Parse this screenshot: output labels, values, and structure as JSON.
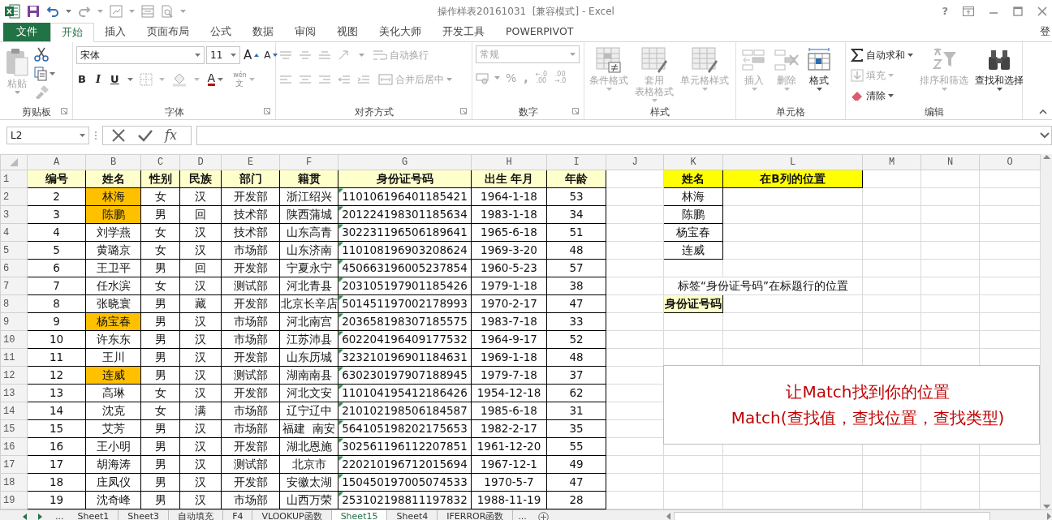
{
  "title_bar": {
    "title": "操作样表20161031  [兼容模式] - Excel",
    "help": "?"
  },
  "ribbon_tabs": [
    {
      "label": "文件",
      "kind": "file",
      "selected": false
    },
    {
      "label": "开始",
      "kind": "tab",
      "selected": true
    },
    {
      "label": "插入",
      "kind": "tab",
      "selected": false
    },
    {
      "label": "页面布局",
      "kind": "tab",
      "selected": false
    },
    {
      "label": "公式",
      "kind": "tab",
      "selected": false
    },
    {
      "label": "数据",
      "kind": "tab",
      "selected": false
    },
    {
      "label": "审阅",
      "kind": "tab",
      "selected": false
    },
    {
      "label": "视图",
      "kind": "tab",
      "selected": false
    },
    {
      "label": "美化大师",
      "kind": "tab",
      "selected": false
    },
    {
      "label": "开发工具",
      "kind": "tab",
      "selected": false
    },
    {
      "label": "POWERPIVOT",
      "kind": "tab",
      "selected": false
    }
  ],
  "account": "登",
  "ribbon": {
    "clipboard": {
      "title": "剪贴板",
      "paste": {
        "label": "粘贴",
        "disabled": true
      }
    },
    "font": {
      "title": "字体",
      "font_name": "宋体",
      "font_size": "11",
      "grow": "A",
      "shrink": "A",
      "bold": "B",
      "italic": "I",
      "underline": "U",
      "font_color": "A",
      "phonetic_top": "wén",
      "phonetic_bottom": "文"
    },
    "alignment": {
      "title": "对齐方式",
      "disabled": true,
      "wrap_text": "自动换行",
      "merge_center": "合并后居中"
    },
    "number": {
      "title": "数字",
      "disabled": true,
      "format": "常规",
      "percent": "%",
      "comma": ",",
      "increase_decimal": [
        "←.0",
        ".00"
      ],
      "decrease_decimal": [
        ".00",
        "→.0"
      ]
    },
    "styles": {
      "title": "样式",
      "buttons": [
        {
          "kind": "conditional",
          "lines": [
            "条件格式"
          ],
          "disabled": true
        },
        {
          "kind": "table",
          "lines": [
            "套用",
            "表格格式"
          ],
          "disabled": true
        },
        {
          "kind": "cellstyle",
          "lines": [
            "单元格样式"
          ],
          "disabled": true
        }
      ]
    },
    "cells": {
      "title": "单元格",
      "buttons": [
        {
          "kind": "insert",
          "lines": [
            "插入"
          ],
          "disabled": true
        },
        {
          "kind": "delete",
          "lines": [
            "删除"
          ],
          "disabled": true
        },
        {
          "kind": "format",
          "lines": [
            "格式"
          ],
          "disabled": false
        }
      ]
    },
    "editing": {
      "title": "编辑",
      "small": [
        {
          "kind": "sum",
          "label": "自动求和",
          "disabled": false
        },
        {
          "kind": "fill",
          "label": "填充",
          "disabled": true
        },
        {
          "kind": "clear",
          "label": "清除",
          "disabled": false
        }
      ],
      "large": [
        {
          "kind": "sort",
          "lines": [
            "排序和筛选"
          ],
          "disabled": true
        },
        {
          "kind": "find",
          "lines": [
            "查找和选择"
          ],
          "disabled": false
        }
      ]
    }
  },
  "formula_bar": {
    "name_box": "L2",
    "function_label": "fx"
  },
  "columns": [
    "A",
    "B",
    "C",
    "D",
    "E",
    "F",
    "G",
    "H",
    "I",
    "J",
    "K",
    "L",
    "M",
    "N",
    "O"
  ],
  "row_numbers": [
    "1",
    "2",
    "3",
    "4",
    "5",
    "6",
    "7",
    "8",
    "9",
    "10",
    "11",
    "12",
    "13",
    "14",
    "15",
    "16",
    "17",
    "18",
    "19"
  ],
  "table": {
    "header": [
      "编号",
      "姓名",
      "性别",
      "民族",
      "部门",
      "籍贯",
      "身份证号码",
      "出生 年月",
      "年龄"
    ],
    "rows": [
      {
        "values": [
          "2",
          "林海",
          "女",
          "汉",
          "开发部",
          "浙江绍兴",
          "110106196401185421",
          "1964-1-18",
          "53"
        ],
        "name_highlighted": true
      },
      {
        "values": [
          "3",
          "陈鹏",
          "男",
          "回",
          "技术部",
          "陕西蒲城",
          "201224198301185634",
          "1983-1-18",
          "34"
        ],
        "name_highlighted": true
      },
      {
        "values": [
          "4",
          "刘学燕",
          "女",
          "汉",
          "技术部",
          "山东高青",
          "302231196506189641",
          "1965-6-18",
          "51"
        ],
        "name_highlighted": false
      },
      {
        "values": [
          "5",
          "黄璐京",
          "女",
          "汉",
          "市场部",
          "山东济南",
          "110108196903208624",
          "1969-3-20",
          "48"
        ],
        "name_highlighted": false
      },
      {
        "values": [
          "6",
          "王卫平",
          "男",
          "回",
          "开发部",
          "宁夏永宁",
          "450663196005237854",
          "1960-5-23",
          "57"
        ],
        "name_highlighted": false
      },
      {
        "values": [
          "7",
          "任水滨",
          "女",
          "汉",
          "测试部",
          "河北青县",
          "203105197901185426",
          "1979-1-18",
          "38"
        ],
        "name_highlighted": false
      },
      {
        "values": [
          "8",
          "张晓寰",
          "男",
          "藏",
          "开发部",
          "北京长辛店",
          "501451197002178993",
          "1970-2-17",
          "47"
        ],
        "name_highlighted": false
      },
      {
        "values": [
          "9",
          "杨宝春",
          "男",
          "汉",
          "市场部",
          "河北南宫",
          "203658198307185575",
          "1983-7-18",
          "33"
        ],
        "name_highlighted": true
      },
      {
        "values": [
          "10",
          "许东东",
          "男",
          "汉",
          "市场部",
          "江苏沛县",
          "602204196409177532",
          "1964-9-17",
          "52"
        ],
        "name_highlighted": false
      },
      {
        "values": [
          "11",
          "王川",
          "男",
          "汉",
          "开发部",
          "山东历城",
          "323210196901184631",
          "1969-1-18",
          "48"
        ],
        "name_highlighted": false
      },
      {
        "values": [
          "12",
          "连威",
          "男",
          "汉",
          "测试部",
          "湖南南县",
          "630230197907188945",
          "1979-7-18",
          "37"
        ],
        "name_highlighted": true
      },
      {
        "values": [
          "13",
          "高琳",
          "女",
          "汉",
          "开发部",
          "河北文安",
          "110104195412186426",
          "1954-12-18",
          "62"
        ],
        "name_highlighted": false
      },
      {
        "values": [
          "14",
          "沈克",
          "女",
          "满",
          "市场部",
          "辽宁辽中",
          "210102198506184587",
          "1985-6-18",
          "31"
        ],
        "name_highlighted": false
      },
      {
        "values": [
          "15",
          "艾芳",
          "男",
          "汉",
          "市场部",
          "福建  南安",
          "564105198202175653",
          "1982-2-17",
          "35"
        ],
        "name_highlighted": false
      },
      {
        "values": [
          "16",
          "王小明",
          "男",
          "汉",
          "开发部",
          "湖北恩施",
          "302561196112207851",
          "1961-12-20",
          "55"
        ],
        "name_highlighted": false
      },
      {
        "values": [
          "17",
          "胡海涛",
          "男",
          "汉",
          "测试部",
          "北京市",
          "220210196712015694",
          "1967-12-1",
          "49"
        ],
        "name_highlighted": false
      },
      {
        "values": [
          "18",
          "庄凤仪",
          "男",
          "汉",
          "开发部",
          "安徽太湖",
          "150450197005074533",
          "1970-5-7",
          "47"
        ],
        "name_highlighted": false
      },
      {
        "values": [
          "19",
          "沈奇峰",
          "男",
          "汉",
          "市场部",
          "山西万荣",
          "253102198811197832",
          "1988-11-19",
          "28"
        ],
        "name_highlighted": false
      }
    ]
  },
  "lookup": {
    "header": [
      "姓名",
      "在B列的位置"
    ],
    "names": [
      "林海",
      "陈鹏",
      "杨宝春",
      "连威"
    ],
    "label_caption": "标签“身份证号码”在标题行的位置",
    "label_cell": "身份证号码"
  },
  "text_box": {
    "lines": [
      "让Match找到你的位置",
      "Match(查找值，查找位置，查找类型)"
    ]
  },
  "sheet_tabs_bar": {
    "leading_more": "...",
    "trailing_more": "..."
  },
  "sheet_tabs": [
    {
      "label": "Sheet1",
      "selected": false
    },
    {
      "label": "Sheet3",
      "selected": false
    },
    {
      "label": "自动填充",
      "selected": false
    },
    {
      "label": "F4",
      "selected": false
    },
    {
      "label": "VLOOKUP函数",
      "selected": false
    },
    {
      "label": "Sheet15",
      "selected": true
    },
    {
      "label": "Sheet4",
      "selected": false
    },
    {
      "label": "IFERROR函数",
      "selected": false
    }
  ]
}
